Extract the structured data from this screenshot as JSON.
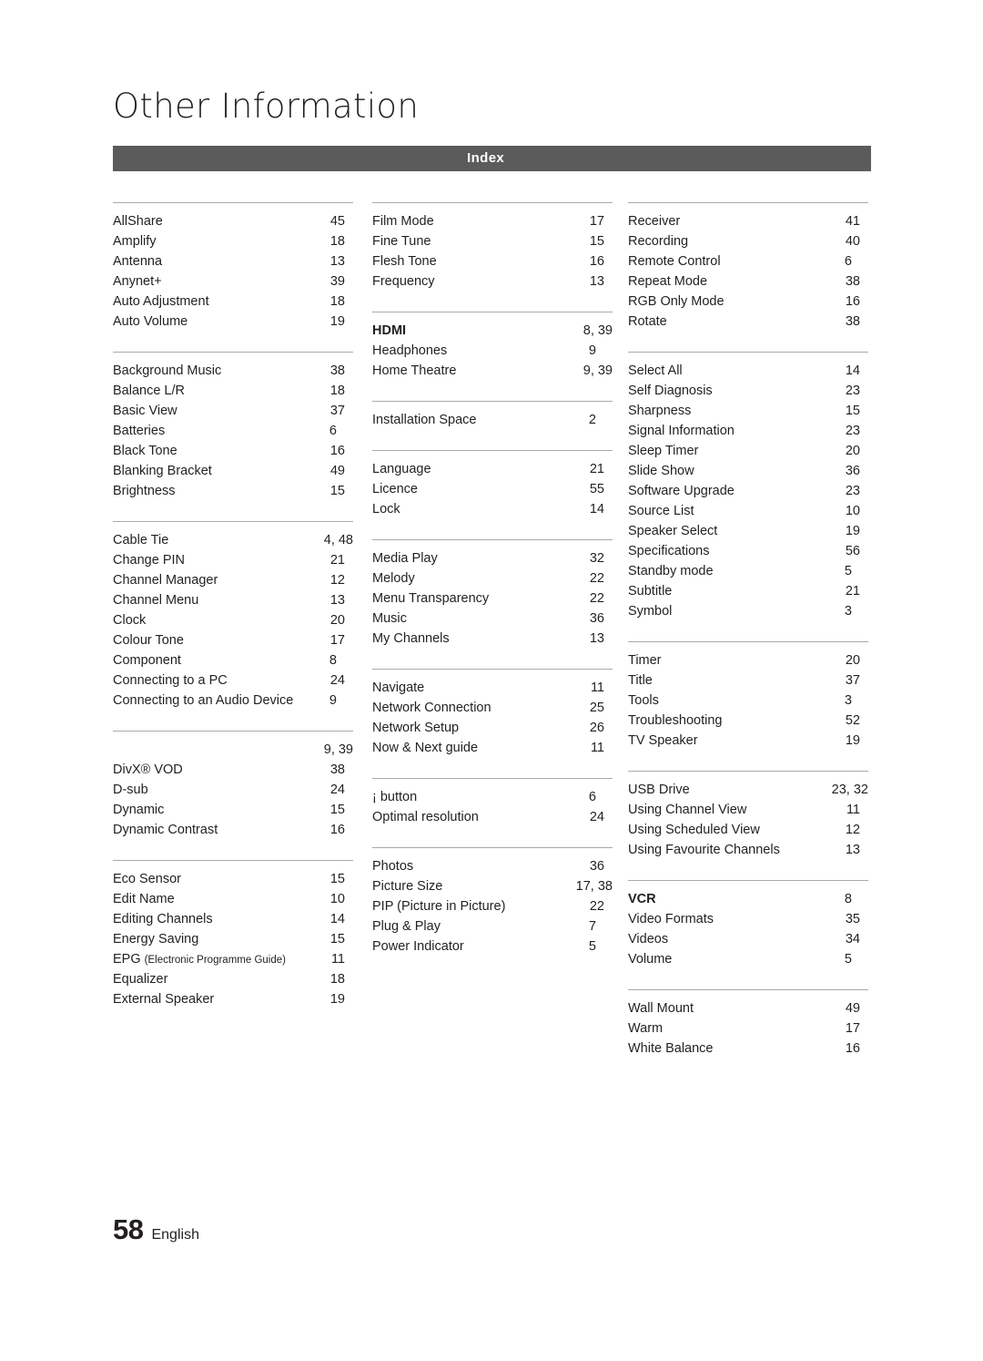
{
  "header": {
    "title": "Other Information",
    "section_label": "Index"
  },
  "footer": {
    "page_number": "58",
    "language": "English"
  },
  "columns": [
    {
      "groups": [
        {
          "entries": [
            {
              "name": "AllShare",
              "page": "45"
            },
            {
              "name": "Amplify",
              "page": "18"
            },
            {
              "name": "Antenna",
              "page": "13"
            },
            {
              "name": "Anynet+",
              "page": "39"
            },
            {
              "name": "Auto Adjustment",
              "page": "18"
            },
            {
              "name": "Auto Volume",
              "page": "19"
            }
          ]
        },
        {
          "entries": [
            {
              "name": "Background Music",
              "page": "38"
            },
            {
              "name": "Balance L/R",
              "page": "18"
            },
            {
              "name": "Basic View",
              "page": "37"
            },
            {
              "name": "Batteries",
              "page": "6"
            },
            {
              "name": "Black Tone",
              "page": "16"
            },
            {
              "name": "Blanking Bracket",
              "page": "49"
            },
            {
              "name": "Brightness",
              "page": "15"
            }
          ]
        },
        {
          "entries": [
            {
              "name": "Cable Tie",
              "page": "4, 48"
            },
            {
              "name": "Change PIN",
              "page": "21"
            },
            {
              "name": "Channel Manager",
              "page": "12"
            },
            {
              "name": "Channel Menu",
              "page": "13"
            },
            {
              "name": "Clock",
              "page": "20"
            },
            {
              "name": "Colour Tone",
              "page": "17"
            },
            {
              "name": "Component",
              "page": "8"
            },
            {
              "name": "Connecting to a PC",
              "page": "24"
            },
            {
              "name": "Connecting to an Audio Device",
              "page": "9"
            }
          ]
        },
        {
          "entries": [
            {
              "name": "",
              "page": "9, 39"
            },
            {
              "name": "DivX® VOD",
              "page": "38"
            },
            {
              "name": "D-sub",
              "page": "24"
            },
            {
              "name": "Dynamic",
              "page": "15"
            },
            {
              "name": "Dynamic Contrast",
              "page": "16"
            }
          ]
        },
        {
          "entries": [
            {
              "name": "Eco Sensor",
              "page": "15"
            },
            {
              "name": "Edit Name",
              "page": "10"
            },
            {
              "name": "Editing Channels",
              "page": "14"
            },
            {
              "name": "Energy Saving",
              "page": "15"
            },
            {
              "name": "EPG (Electronic Programme Guide)",
              "page": "11",
              "small_suffix": true
            },
            {
              "name": "Equalizer",
              "page": "18"
            },
            {
              "name": "External Speaker",
              "page": "19"
            }
          ]
        }
      ]
    },
    {
      "groups": [
        {
          "entries": [
            {
              "name": "Film Mode",
              "page": "17"
            },
            {
              "name": "Fine Tune",
              "page": "15"
            },
            {
              "name": "Flesh Tone",
              "page": "16"
            },
            {
              "name": "Frequency",
              "page": "13"
            }
          ]
        },
        {
          "entries": [
            {
              "name": "HDMI",
              "page": "8, 39",
              "bold": true
            },
            {
              "name": "Headphones",
              "page": "9"
            },
            {
              "name": "Home Theatre",
              "page": "9, 39"
            }
          ]
        },
        {
          "entries": [
            {
              "name": "Installation Space",
              "page": "2"
            }
          ]
        },
        {
          "entries": [
            {
              "name": "Language",
              "page": "21"
            },
            {
              "name": "Licence",
              "page": "55"
            },
            {
              "name": "Lock",
              "page": "14"
            }
          ]
        },
        {
          "entries": [
            {
              "name": "Media Play",
              "page": "32"
            },
            {
              "name": "Melody",
              "page": "22"
            },
            {
              "name": "Menu Transparency",
              "page": "22"
            },
            {
              "name": "Music",
              "page": "36"
            },
            {
              "name": "My Channels",
              "page": "13"
            }
          ]
        },
        {
          "entries": [
            {
              "name": "Navigate",
              "page": "11"
            },
            {
              "name": "Network Connection",
              "page": "25"
            },
            {
              "name": "Network Setup",
              "page": "26"
            },
            {
              "name": "Now & Next guide",
              "page": "11"
            }
          ]
        },
        {
          "entries": [
            {
              "name": "¡    button",
              "page": "6"
            },
            {
              "name": "Optimal resolution",
              "page": "24"
            }
          ]
        },
        {
          "entries": [
            {
              "name": "Photos",
              "page": "36"
            },
            {
              "name": "Picture Size",
              "page": "17, 38"
            },
            {
              "name": "PIP (Picture in Picture)",
              "page": "22"
            },
            {
              "name": "Plug & Play",
              "page": "7"
            },
            {
              "name": "Power Indicator",
              "page": "5"
            }
          ]
        }
      ]
    },
    {
      "groups": [
        {
          "entries": [
            {
              "name": "Receiver",
              "page": "41"
            },
            {
              "name": "Recording",
              "page": "40"
            },
            {
              "name": "Remote Control",
              "page": "6"
            },
            {
              "name": "Repeat Mode",
              "page": "38"
            },
            {
              "name": "RGB Only Mode",
              "page": "16"
            },
            {
              "name": "Rotate",
              "page": "38"
            }
          ]
        },
        {
          "entries": [
            {
              "name": "Select All",
              "page": "14"
            },
            {
              "name": "Self Diagnosis",
              "page": "23"
            },
            {
              "name": "Sharpness",
              "page": "15"
            },
            {
              "name": "Signal Information",
              "page": "23"
            },
            {
              "name": "Sleep Timer",
              "page": "20"
            },
            {
              "name": "Slide Show",
              "page": "36"
            },
            {
              "name": "Software Upgrade",
              "page": "23"
            },
            {
              "name": "Source List",
              "page": "10"
            },
            {
              "name": "Speaker Select",
              "page": "19"
            },
            {
              "name": "Specifications",
              "page": "56"
            },
            {
              "name": "Standby mode",
              "page": "5"
            },
            {
              "name": "Subtitle",
              "page": "21"
            },
            {
              "name": "Symbol",
              "page": "3"
            }
          ]
        },
        {
          "entries": [
            {
              "name": "Timer",
              "page": "20"
            },
            {
              "name": "Title",
              "page": "37"
            },
            {
              "name": "Tools",
              "page": "3"
            },
            {
              "name": "Troubleshooting",
              "page": "52"
            },
            {
              "name": "TV Speaker",
              "page": "19"
            }
          ]
        },
        {
          "entries": [
            {
              "name": "USB Drive",
              "page": "23, 32"
            },
            {
              "name": "Using Channel View",
              "page": "11"
            },
            {
              "name": "Using Scheduled View",
              "page": "12"
            },
            {
              "name": "Using Favourite Channels",
              "page": "13"
            }
          ]
        },
        {
          "entries": [
            {
              "name": "VCR",
              "page": "8",
              "bold": true
            },
            {
              "name": "Video Formats",
              "page": "35"
            },
            {
              "name": "Videos",
              "page": "34"
            },
            {
              "name": "Volume",
              "page": "5"
            }
          ]
        },
        {
          "entries": [
            {
              "name": "Wall Mount",
              "page": "49"
            },
            {
              "name": "Warm",
              "page": "17"
            },
            {
              "name": "White Balance",
              "page": "16"
            }
          ]
        }
      ]
    }
  ]
}
